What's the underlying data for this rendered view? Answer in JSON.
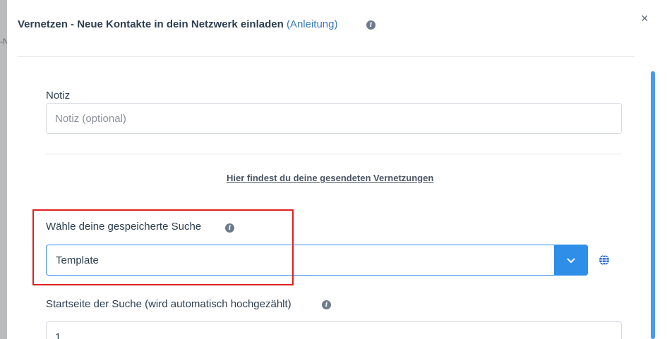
{
  "background": {
    "fragment": "-N"
  },
  "modal": {
    "title": "Vernetzen - Neue Kontakte in dein Netzwerk einladen",
    "title_link": "(Anleitung)",
    "close_symbol": "×"
  },
  "form": {
    "notiz": {
      "label": "Notiz",
      "placeholder": "Notiz (optional)",
      "value": ""
    },
    "sent_link": "Hier findest du deine gesendeten Vernetzungen",
    "saved_search": {
      "label": "Wähle deine gespeicherte Suche",
      "value": "Template"
    },
    "start_page": {
      "label": "Startseite der Suche (wird automatisch hochgezählt)",
      "value": "1"
    }
  },
  "colors": {
    "accent": "#2f8ee8",
    "highlight": "#e02020",
    "link": "#3a78c2"
  },
  "icons": [
    "info-icon",
    "close-icon",
    "chevron-down-icon",
    "globe-icon"
  ]
}
